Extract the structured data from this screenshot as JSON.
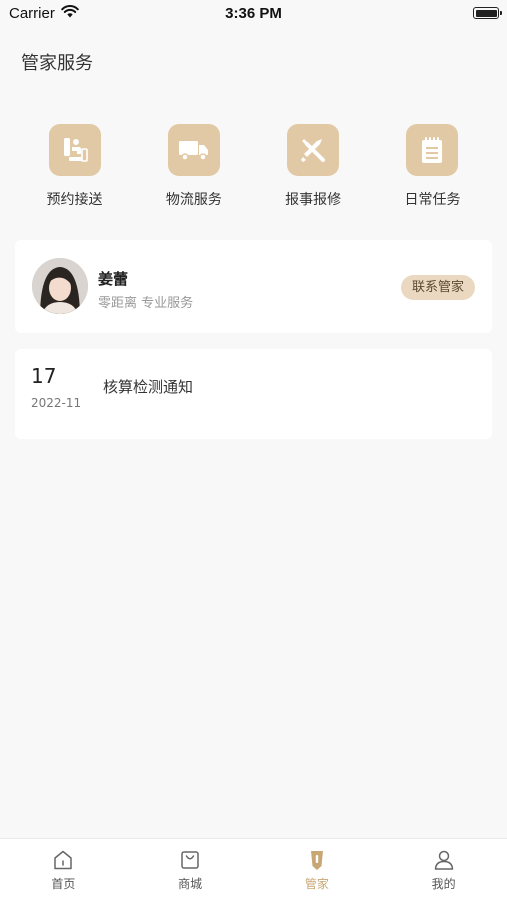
{
  "status_bar": {
    "carrier": "Carrier",
    "time": "3:36 PM"
  },
  "page": {
    "title": "管家服务"
  },
  "services": [
    {
      "label": "预约接送",
      "icon": "pickup-icon"
    },
    {
      "label": "物流服务",
      "icon": "truck-icon"
    },
    {
      "label": "报事报修",
      "icon": "repair-tools-icon"
    },
    {
      "label": "日常任务",
      "icon": "notepad-icon"
    }
  ],
  "manager": {
    "name": "姜蕾",
    "description": "零距离 专业服务",
    "contact_label": "联系管家"
  },
  "notice": {
    "day": "17",
    "month": "2022-11",
    "title": "核算检测通知"
  },
  "tabs": [
    {
      "label": "首页",
      "icon": "home-icon",
      "active": false
    },
    {
      "label": "商城",
      "icon": "shopping-bag-icon",
      "active": false
    },
    {
      "label": "管家",
      "icon": "butler-tie-icon",
      "active": true
    },
    {
      "label": "我的",
      "icon": "user-icon",
      "active": false
    }
  ],
  "colors": {
    "accent": "#c9a774",
    "icon_tile": "#e2c9a5",
    "contact_button_bg": "#ead9c0",
    "page_bg": "#f8f8f8"
  }
}
